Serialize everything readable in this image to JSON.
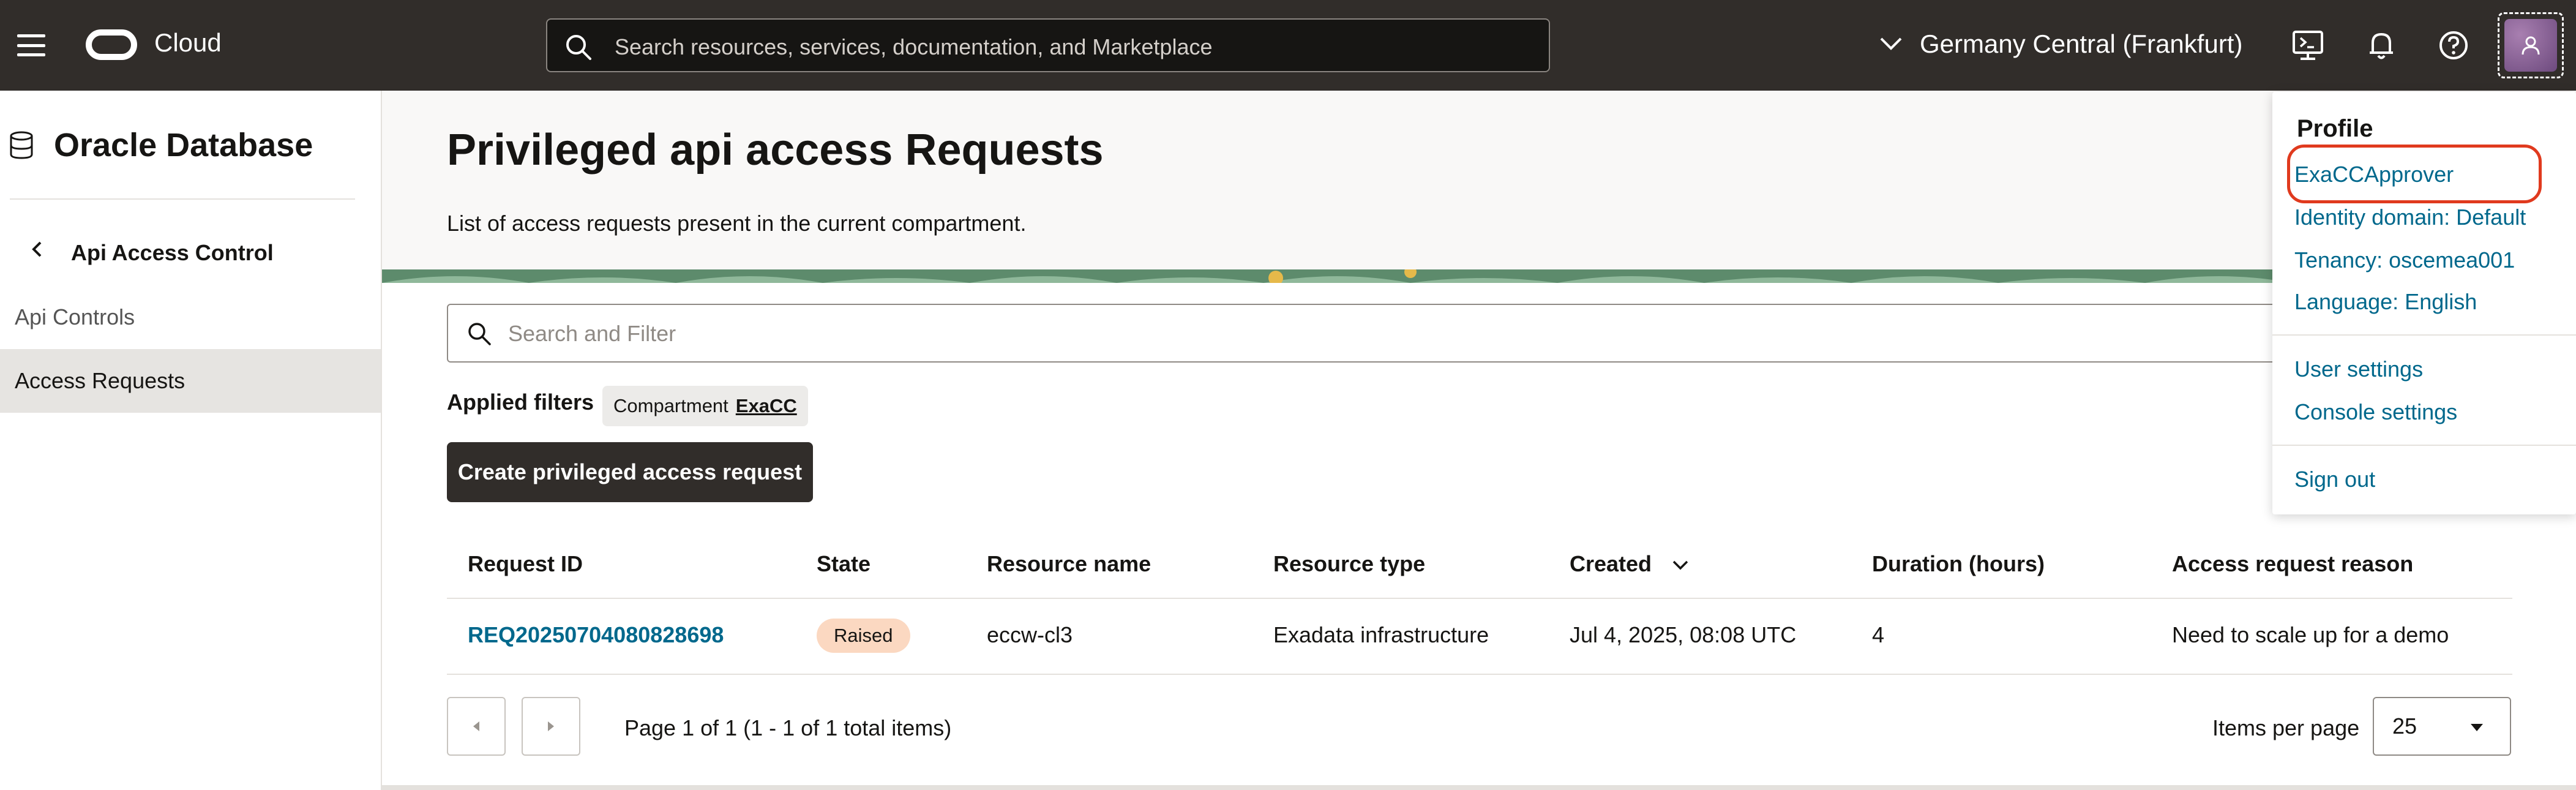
{
  "header": {
    "brand": "Cloud",
    "search_placeholder": "Search resources, services, documentation, and Marketplace",
    "region": "Germany Central (Frankfurt)"
  },
  "sidebar": {
    "title": "Oracle Database",
    "section": "Api Access Control",
    "items": [
      {
        "label": "Api Controls",
        "active": false
      },
      {
        "label": "Access Requests",
        "active": true
      }
    ]
  },
  "main": {
    "title": "Privileged api access Requests",
    "subtitle": "List of access requests present in the current compartment.",
    "filter_placeholder": "Search and Filter",
    "applied_filters_label": "Applied filters",
    "filter_chip": {
      "key": "Compartment",
      "value": "ExaCC"
    },
    "create_button": "Create privileged access request"
  },
  "table": {
    "columns": [
      "Request ID",
      "State",
      "Resource name",
      "Resource type",
      "Created",
      "Duration (hours)",
      "Access request reason"
    ],
    "rows": [
      {
        "request_id": "REQ20250704080828698",
        "state": "Raised",
        "resource_name": "eccw-cl3",
        "resource_type": "Exadata infrastructure",
        "created": "Jul 4, 2025, 08:08 UTC",
        "duration": "4",
        "reason": "Need to scale up for a demo"
      }
    ]
  },
  "pagination": {
    "text": "Page 1 of 1 (1 - 1 of 1 total items)",
    "items_per_page_label": "Items per page",
    "items_per_page": "25"
  },
  "profile_menu": {
    "title": "Profile",
    "user": "ExaCCApprover",
    "identity_domain": "Identity domain: Default",
    "tenancy": "Tenancy: oscemea001",
    "language": "Language: English",
    "user_settings": "User settings",
    "console_settings": "Console settings",
    "sign_out": "Sign out"
  },
  "colors": {
    "header_bg": "#312d2a",
    "link": "#00688c",
    "badge_raised": "#fbd8c1",
    "highlight": "#e03a1e"
  }
}
